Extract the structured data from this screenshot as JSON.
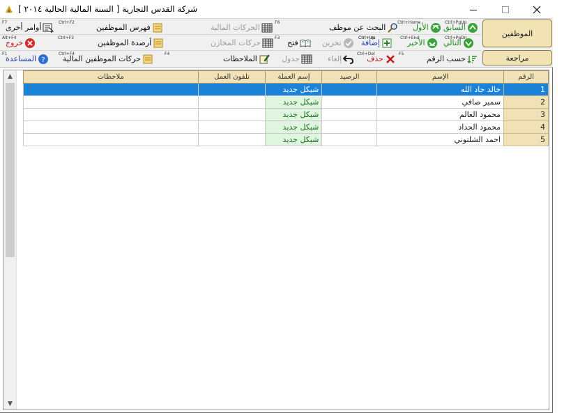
{
  "window": {
    "title": "شركة القدس التجارية  [ السنة المالية الحالية ٢٠١٤ ]"
  },
  "toolbar": {
    "row1": {
      "other_commands": {
        "label": "أوامر أخرى",
        "hotkey": "F7"
      },
      "employee_index": {
        "label": "فهرس الموظفين",
        "hotkey": "Ctrl+F2"
      },
      "financial_movements": {
        "label": "الحركات المالية",
        "hotkey": "F6"
      },
      "search_employee": {
        "label": "البحث عن موظف",
        "hotkey": "Ctrl+Home"
      },
      "first": {
        "label": "الأول",
        "hotkey": "Ctrl+Home"
      },
      "previous": {
        "label": "السابق",
        "hotkey": "Ctrl+PgUp"
      }
    },
    "row2": {
      "exit": {
        "label": "خروج",
        "hotkey": "Alt+F4"
      },
      "employee_balances": {
        "label": "أرصدة الموظفين",
        "hotkey": "Ctrl+F3"
      },
      "warehouse_movements": {
        "label": "حركات المخازن",
        "hotkey": "F3"
      },
      "open": {
        "label": "فتح",
        "hotkey": "Ctrl+Up"
      },
      "store": {
        "label": "تخزين",
        "hotkey": ""
      },
      "add": {
        "label": "إضافة",
        "hotkey": "Ctrl+Ins"
      },
      "last": {
        "label": "الأخير",
        "hotkey": "Ctrl+End"
      },
      "next": {
        "label": "التالي",
        "hotkey": "Ctrl+PgDn"
      }
    },
    "row3": {
      "help": {
        "label": "المساعدة",
        "hotkey": "F1"
      },
      "employee_financial_movements": {
        "label": "حركات الموظفين المالية",
        "hotkey": "Ctrl+F4"
      },
      "notes": {
        "label": "الملاحظات",
        "hotkey": "F4"
      },
      "table": {
        "label": "جدول",
        "hotkey": ""
      },
      "cancel": {
        "label": "إلغاء",
        "hotkey": ""
      },
      "delete": {
        "label": "حذف",
        "hotkey": "Ctrl+Del"
      },
      "by_number": {
        "label": "حسب الرقم",
        "hotkey": "F5"
      }
    },
    "employees_button": "الموظفين",
    "review_button": "مراجعة"
  },
  "grid": {
    "columns": [
      "الرقم",
      "الإسم",
      "الرصيد",
      "إسم العملة",
      "تلفون العمل",
      "ملاحظات"
    ],
    "rows": [
      {
        "num": "1",
        "name": "خالد جاد الله",
        "balance": "",
        "currency": "شيكل جديد",
        "phone": "",
        "notes": "",
        "selected": true
      },
      {
        "num": "2",
        "name": "سمير صافي",
        "balance": "",
        "currency": "شيكل جديد",
        "phone": "",
        "notes": ""
      },
      {
        "num": "3",
        "name": "محمود العالم",
        "balance": "",
        "currency": "شيكل جديد",
        "phone": "",
        "notes": ""
      },
      {
        "num": "4",
        "name": "محمود الحداد",
        "balance": "",
        "currency": "شيكل جديد",
        "phone": "",
        "notes": ""
      },
      {
        "num": "5",
        "name": "احمد الشلتوني",
        "balance": "",
        "currency": "شيكل جديد",
        "phone": "",
        "notes": ""
      }
    ]
  },
  "colors": {
    "accent_selected": "#1a83d7",
    "header_tan": "#f0e2b6",
    "currency_green": "#dff5df"
  }
}
